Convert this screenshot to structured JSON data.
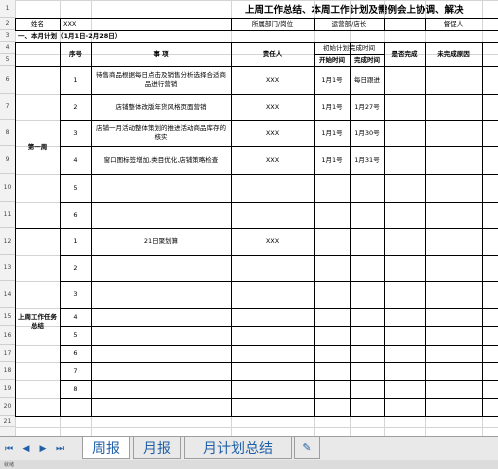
{
  "title": "上周工作总结、本周工作计划及需例会上协调、解决",
  "info_row": {
    "name_label": "姓名",
    "name_value": "XXX",
    "dept_label": "所属部门/岗位",
    "dept_value": "运营部/店长",
    "supervisor_label": "督促人"
  },
  "section_label": "一、本月计划（1月1日-2月28日）",
  "headers": {
    "seq": "序号",
    "item": "事 项",
    "owner": "责任人",
    "time_group": "初始计划完成时间",
    "start": "开始时间",
    "end": "完成时间",
    "done": "是否完成",
    "reason": "未完成原因"
  },
  "group1_label": "第一周",
  "group2_label": "上周工作任务总结",
  "week1_rows": [
    {
      "seq": "1",
      "item": "待售商品根据每日点击及销售分析选择合适商品进行营销",
      "owner": "XXX",
      "start": "1月1号",
      "end": "每日跟进"
    },
    {
      "seq": "2",
      "item": "店铺整体改版年货风格页面营销",
      "owner": "XXX",
      "start": "1月1号",
      "end": "1月27号"
    },
    {
      "seq": "3",
      "item": "店铺一月活动整体策划的推进活动商品库存的核实",
      "owner": "XXX",
      "start": "1月1号",
      "end": "1月30号"
    },
    {
      "seq": "4",
      "item": "窗口图标签增加,类目优化,店铺策略检查",
      "owner": "XXX",
      "start": "1月1号",
      "end": "1月31号"
    },
    {
      "seq": "5",
      "item": "",
      "owner": "",
      "start": "",
      "end": ""
    },
    {
      "seq": "6",
      "item": "",
      "owner": "",
      "start": "",
      "end": ""
    }
  ],
  "week2_rows": [
    {
      "seq": "1",
      "item": "21日聚划算",
      "owner": "XXX"
    },
    {
      "seq": "2",
      "item": "",
      "owner": ""
    },
    {
      "seq": "3",
      "item": "",
      "owner": ""
    },
    {
      "seq": "4",
      "item": "",
      "owner": ""
    },
    {
      "seq": "5",
      "item": "",
      "owner": ""
    },
    {
      "seq": "6",
      "item": "",
      "owner": ""
    },
    {
      "seq": "7",
      "item": "",
      "owner": ""
    },
    {
      "seq": "8",
      "item": "",
      "owner": ""
    }
  ],
  "row_numbers": [
    "1",
    "2",
    "3",
    "4",
    "5",
    "6",
    "7",
    "8",
    "9",
    "10",
    "11",
    "12",
    "13",
    "14",
    "15",
    "16",
    "17",
    "18",
    "19",
    "20",
    "21"
  ],
  "tabs": [
    {
      "label": "周报",
      "active": true
    },
    {
      "label": "月报",
      "active": false
    },
    {
      "label": "月计划总结",
      "active": false
    }
  ],
  "nav_icons": [
    "first-sheet-icon",
    "prev-sheet-icon",
    "next-sheet-icon",
    "last-sheet-icon"
  ],
  "new_sheet_icon": "new-sheet-icon",
  "status_text": "就绪"
}
